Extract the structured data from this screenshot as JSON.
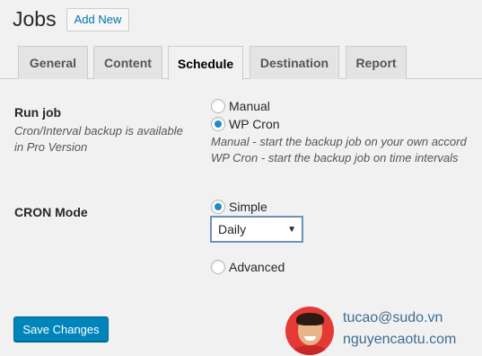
{
  "header": {
    "title": "Jobs",
    "add_new_label": "Add New"
  },
  "tabs": [
    {
      "label": "General"
    },
    {
      "label": "Content"
    },
    {
      "label": "Schedule",
      "active": true
    },
    {
      "label": "Destination"
    },
    {
      "label": "Report"
    }
  ],
  "run_job": {
    "label": "Run job",
    "note_line1": "Cron/Interval backup is available",
    "note_line2": "in Pro Version",
    "options": [
      {
        "label": "Manual",
        "checked": false
      },
      {
        "label": "WP Cron",
        "checked": true
      }
    ],
    "help_line1": "Manual - start the backup job on your own accord",
    "help_line2": "WP Cron - start the backup job on time intervals"
  },
  "cron_mode": {
    "label": "CRON Mode",
    "simple_label": "Simple",
    "simple_checked": true,
    "frequency_selected": "Daily",
    "advanced_label": "Advanced",
    "advanced_checked": false
  },
  "save_button_label": "Save Changes",
  "watermark": {
    "email": "tucao@sudo.vn",
    "site": "nguyencaotu.com"
  },
  "colors": {
    "accent": "#0085ba",
    "link": "#0073aa",
    "radio_dot": "#1e8cbe",
    "watermark": "#3b6e94"
  }
}
